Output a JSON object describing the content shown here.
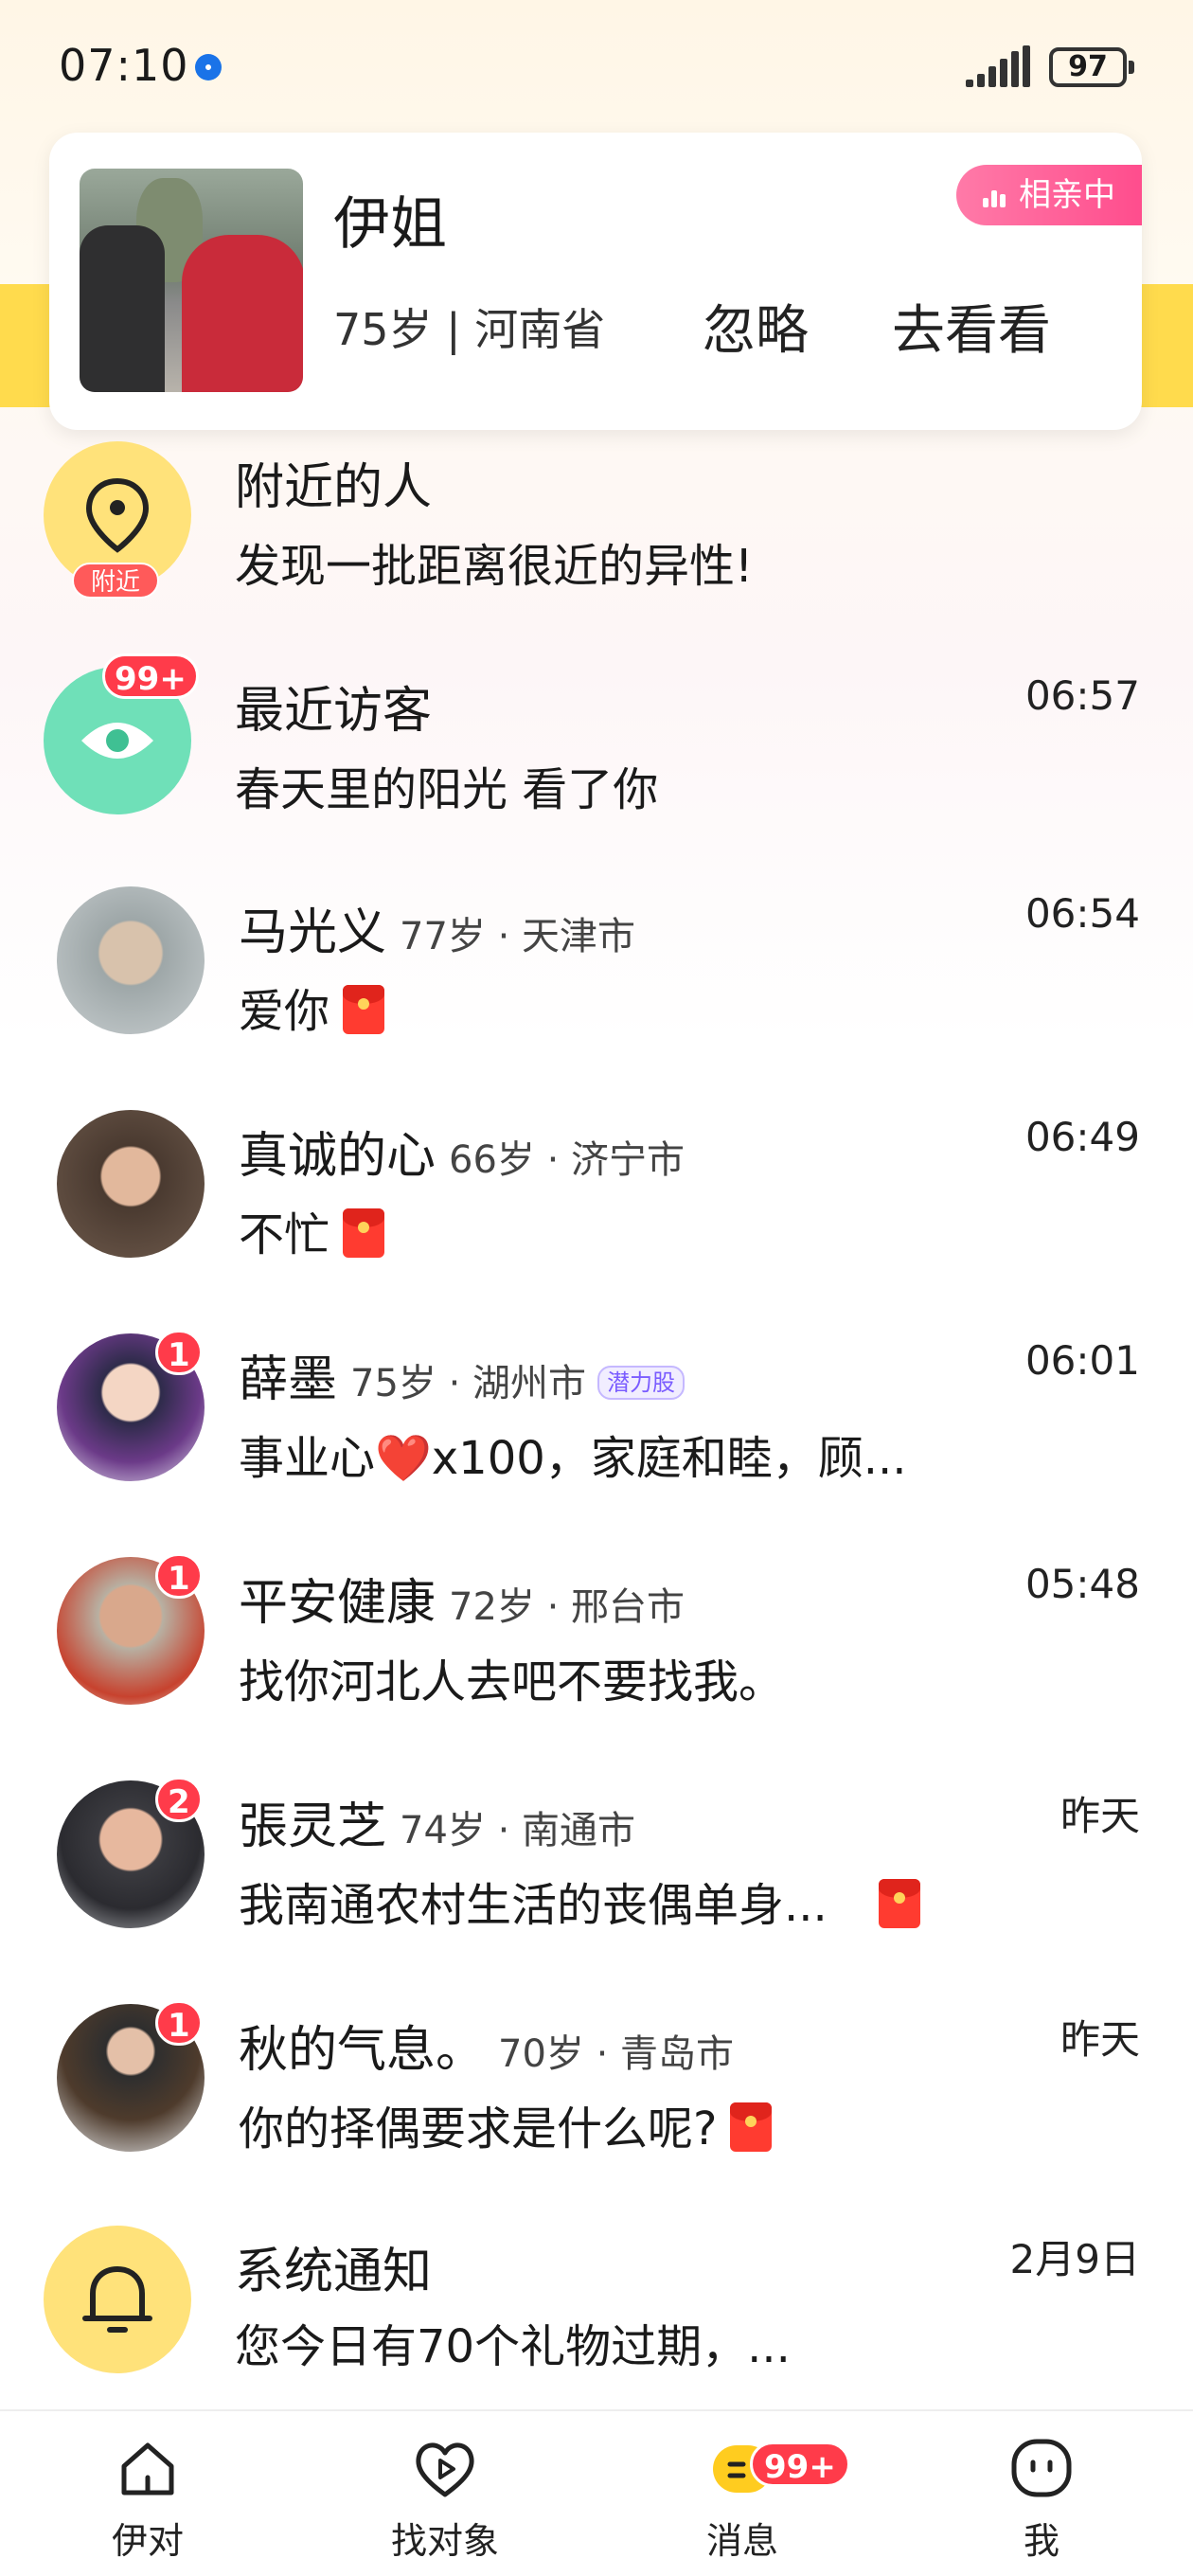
{
  "status": {
    "time": "07:10",
    "battery": "97"
  },
  "match": {
    "name": "伊姐",
    "age_location": "75岁 | 河南省",
    "ignore_label": "忽略",
    "go_label": "去看看",
    "badge": "相亲中"
  },
  "nearby": {
    "title": "附近的人",
    "subtitle": "发现一批距离很近的异性!",
    "tag": "附近"
  },
  "visitors": {
    "title": "最近访客",
    "subtitle": "春天里的阳光 看了你",
    "time": "06:57",
    "badge": "99+"
  },
  "chats": [
    {
      "name": "马光义",
      "meta": "77岁 · 天津市",
      "message": "爱你",
      "time": "06:54",
      "unread": "",
      "redpack": true
    },
    {
      "name": "真诚的心",
      "meta": "66岁 · 济宁市",
      "message": "不忙",
      "time": "06:49",
      "unread": "",
      "redpack": true
    },
    {
      "name": "薛墨",
      "meta": "75岁 · 湖州市",
      "tag": "潜力股",
      "message": "事业心❤️x100，家庭和睦，顾...",
      "time": "06:01",
      "unread": "1",
      "redpack": false
    },
    {
      "name": "平安健康",
      "meta": "72岁 · 邢台市",
      "message": "找你河北人去吧不要找我。",
      "time": "05:48",
      "unread": "1",
      "redpack": false
    },
    {
      "name": "張灵芝",
      "meta": "74岁 · 南通市",
      "message": "我南通农村生活的丧偶单身...",
      "time": "昨天",
      "unread": "2",
      "redpack": true
    },
    {
      "name": "秋的气息。",
      "meta": "70岁 · 青岛市",
      "message": "你的择偶要求是什么呢?",
      "time": "昨天",
      "unread": "1",
      "redpack": true
    }
  ],
  "system": {
    "title": "系统通知",
    "subtitle": "您今日有70个礼物过期，...",
    "time": "2月9日"
  },
  "tabs": [
    {
      "label": "伊对",
      "icon": "home-icon"
    },
    {
      "label": "找对象",
      "icon": "heart-play-icon"
    },
    {
      "label": "消息",
      "icon": "message-icon",
      "badge": "99+"
    },
    {
      "label": "我",
      "icon": "smile-face-icon"
    }
  ],
  "colors": {
    "accent_yellow": "#ffdb4d",
    "badge_red": "#ff3b4a",
    "pink": "#ff4d8d",
    "visitor_green": "#3fd8a6"
  }
}
